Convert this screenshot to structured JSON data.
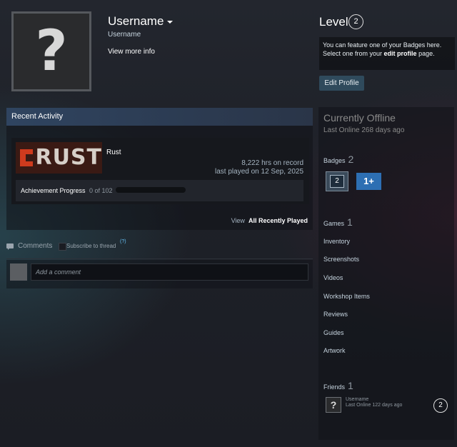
{
  "profile": {
    "username": "Username",
    "real_name": "Username",
    "view_more": "View more info",
    "avatar_glyph": "?"
  },
  "level": {
    "label": "Level",
    "value": "2",
    "badge_note_pre": "You can feature one of your Badges here. Select one from your ",
    "badge_note_link": "edit profile",
    "badge_note_post": " page.",
    "edit_button": "Edit Profile"
  },
  "recent_activity": {
    "title": "Recent Activity",
    "game": {
      "logo_text": "RUST",
      "name": "Rust",
      "hours": "8,222 hrs on record",
      "last_played": "last played on 12 Sep, 2025",
      "achievement_label": "Achievement Progress",
      "achievement_count": "0 of 102",
      "achievement_progress": 0
    },
    "view_prefix": "View",
    "view_all": "All Recently Played"
  },
  "comments": {
    "label": "Comments",
    "subscribe": "Subscribe to thread",
    "help": "(?)",
    "placeholder": "Add a comment"
  },
  "sidebar": {
    "status": "Currently Offline",
    "last_online": "Last Online 268 days ago",
    "badges_label": "Badges",
    "badges_count": "2",
    "badge1_value": "2",
    "badge2_value": "1+",
    "games_label": "Games",
    "games_count": "1",
    "links": [
      "Inventory",
      "Screenshots",
      "Videos",
      "Workshop Items",
      "Reviews",
      "Guides",
      "Artwork"
    ],
    "friends_label": "Friends",
    "friends_count": "1",
    "friend": {
      "avatar_glyph": "?",
      "name": "Username",
      "status": "Last Online 122 days ago",
      "level": "2"
    }
  },
  "colors": {
    "accent_button": "#2f4a5c",
    "badge_blue": "#2d6fb3",
    "rust_red": "#cf3b1e"
  }
}
